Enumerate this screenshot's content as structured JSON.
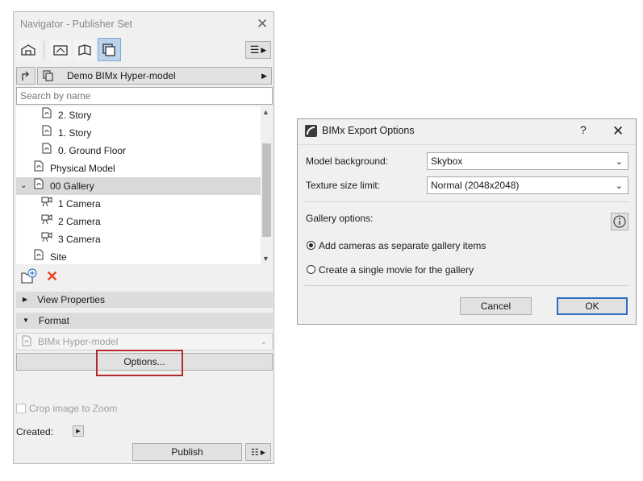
{
  "navigator": {
    "title": "Navigator - Publisher Set",
    "set_name": "Demo BIMx Hyper-model",
    "search_placeholder": "Search by name",
    "tree": [
      {
        "label": "2. Story"
      },
      {
        "label": "1. Story"
      },
      {
        "label": "0. Ground Floor"
      },
      {
        "label": "Physical Model"
      },
      {
        "label": "00 Gallery"
      },
      {
        "label": "1 Camera"
      },
      {
        "label": "2 Camera"
      },
      {
        "label": "3 Camera"
      },
      {
        "label": "Site"
      }
    ],
    "view_properties_label": "View Properties",
    "format_label": "Format",
    "format_value": "BIMx Hyper-model",
    "options_label": "Options...",
    "crop_label": "Crop image to Zoom",
    "created_label": "Created:",
    "publish_label": "Publish"
  },
  "dialog": {
    "title": "BIMx Export Options",
    "help_label": "?",
    "model_background_label": "Model background:",
    "model_background_value": "Skybox",
    "texture_label": "Texture size limit:",
    "texture_value": "Normal (2048x2048)",
    "gallery_options_label": "Gallery options:",
    "radio_separate_label": "Add cameras as separate gallery items",
    "radio_single_label": "Create a single movie for the gallery",
    "cancel_label": "Cancel",
    "ok_label": "OK"
  },
  "colors": {
    "highlight_border": "#b22a2a",
    "ok_border": "#2b6fc2",
    "delete_red": "#e8452a"
  }
}
